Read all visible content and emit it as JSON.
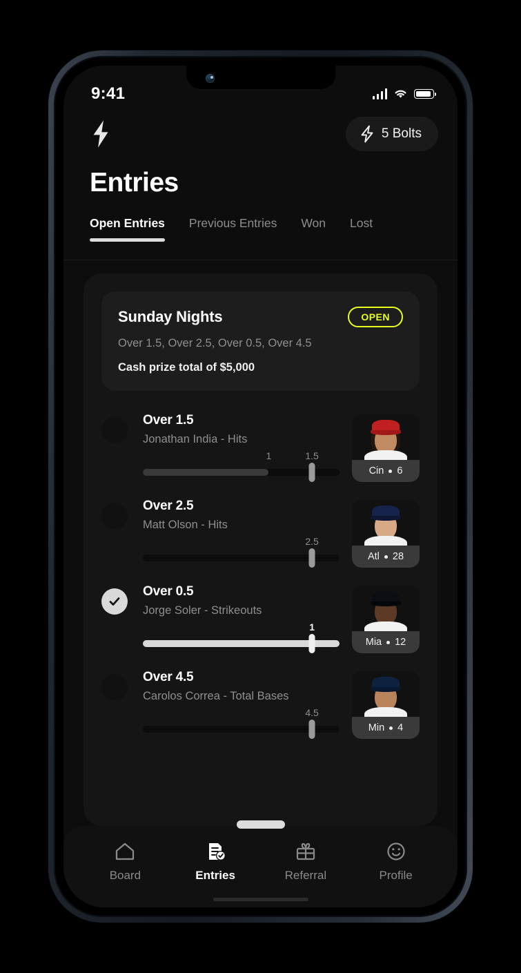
{
  "status_bar": {
    "time": "9:41",
    "signal_icon": "cellular-signal-icon",
    "wifi_icon": "wifi-icon",
    "battery_icon": "battery-icon"
  },
  "header": {
    "logo_icon": "bolt-logo-icon",
    "bolts_icon": "bolt-icon",
    "bolts_label": "5 Bolts"
  },
  "page": {
    "title": "Entries"
  },
  "tabs": [
    {
      "label": "Open Entries",
      "active": true
    },
    {
      "label": "Previous Entries",
      "active": false
    },
    {
      "label": "Won",
      "active": false
    },
    {
      "label": "Lost",
      "active": false
    }
  ],
  "entry": {
    "title": "Sunday Nights",
    "status_badge": "OPEN",
    "picks_summary": "Over 1.5, Over 2.5, Over 0.5, Over 4.5",
    "prize": "Cash prize total of $5,000"
  },
  "picks": [
    {
      "title": "Over 1.5",
      "subtitle": "Jonathan India - Hits",
      "completed": false,
      "current_label": "1",
      "target_label": "1.5",
      "current_pct": 64,
      "target_pct": 86,
      "player": {
        "team": "Cin",
        "number": "6"
      }
    },
    {
      "title": "Over 2.5",
      "subtitle": "Matt Olson - Hits",
      "completed": false,
      "current_label": "",
      "target_label": "2.5",
      "current_pct": 0,
      "target_pct": 86,
      "player": {
        "team": "Atl",
        "number": "28"
      }
    },
    {
      "title": "Over 0.5",
      "subtitle": "Jorge Soler - Strikeouts",
      "completed": true,
      "current_label": "1",
      "target_label": "",
      "current_pct": 86,
      "target_pct": 86,
      "player": {
        "team": "Mia",
        "number": "12"
      }
    },
    {
      "title": "Over 4.5",
      "subtitle": "Carolos Correa - Total Bases",
      "completed": false,
      "current_label": "",
      "target_label": "4.5",
      "current_pct": 0,
      "target_pct": 86,
      "player": {
        "team": "Min",
        "number": "4"
      }
    }
  ],
  "bottom_nav": [
    {
      "label": "Board",
      "icon": "home-icon",
      "active": false
    },
    {
      "label": "Entries",
      "icon": "document-check-icon",
      "active": true
    },
    {
      "label": "Referral",
      "icon": "gift-icon",
      "active": false
    },
    {
      "label": "Profile",
      "icon": "smiley-icon",
      "active": false
    }
  ],
  "colors": {
    "accent_yellow": "#e7ff1e",
    "screen_bg": "#0d0d0d",
    "card_bg": "#151515",
    "muted_text": "#8f8f8f"
  }
}
